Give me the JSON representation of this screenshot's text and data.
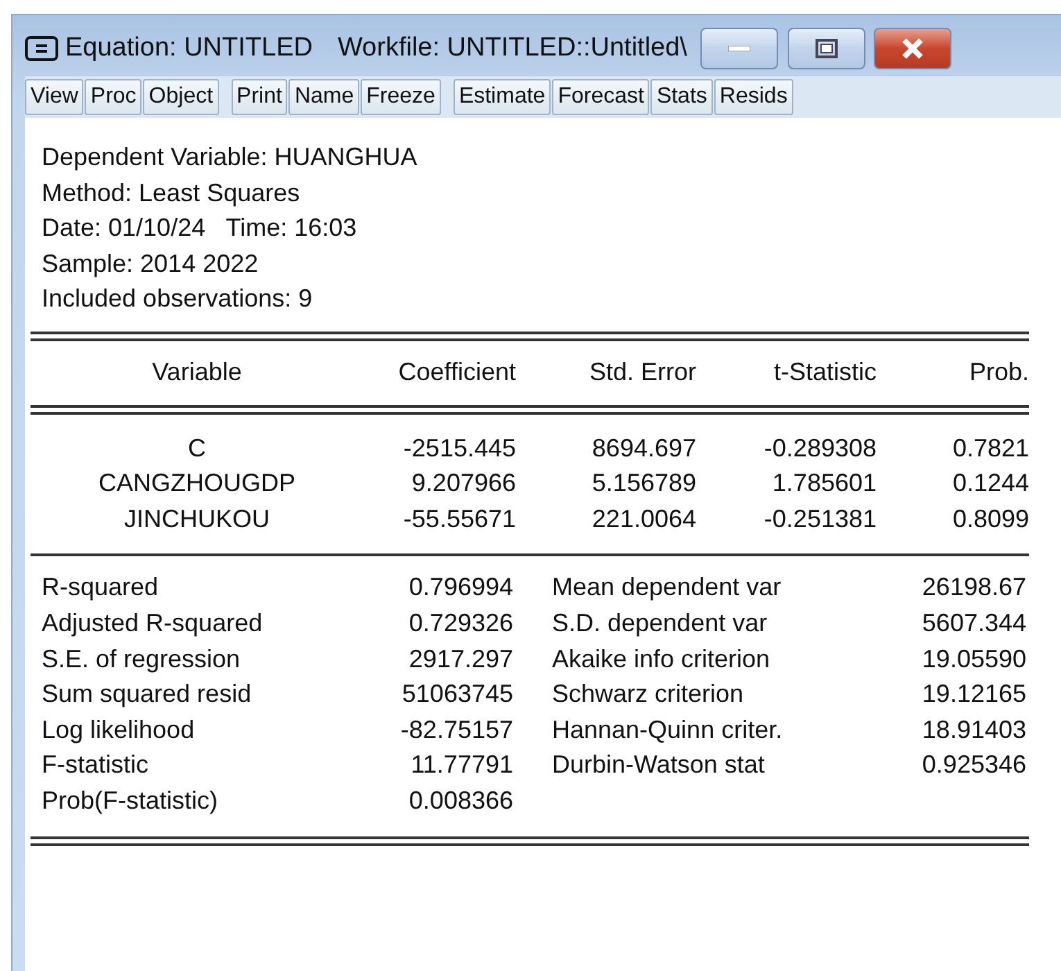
{
  "window": {
    "title": "Equation: UNTITLED",
    "workfile": "Workfile: UNTITLED::Untitled\\"
  },
  "toolbar": [
    [
      "View",
      "Proc",
      "Object"
    ],
    [
      "Print",
      "Name",
      "Freeze"
    ],
    [
      "Estimate",
      "Forecast",
      "Stats",
      "Resids"
    ]
  ],
  "header": [
    "Dependent Variable: HUANGHUA",
    "Method: Least Squares",
    "Date: 01/10/24   Time: 16:03",
    "Sample: 2014 2022",
    "Included observations: 9"
  ],
  "table": {
    "columns": [
      "Variable",
      "Coefficient",
      "Std. Error",
      "t-Statistic",
      "Prob."
    ],
    "rows": [
      [
        "C",
        "-2515.445",
        "8694.697",
        "-0.289308",
        "0.7821"
      ],
      [
        "CANGZHOUGDP",
        "9.207966",
        "5.156789",
        "1.785601",
        "0.1244"
      ],
      [
        "JINCHUKOU",
        "-55.55671",
        "221.0064",
        "-0.251381",
        "0.8099"
      ]
    ]
  },
  "statistics": [
    [
      "R-squared",
      "0.796994",
      "Mean dependent var",
      "26198.67"
    ],
    [
      "Adjusted R-squared",
      "0.729326",
      "S.D. dependent var",
      "5607.344"
    ],
    [
      "S.E. of regression",
      "2917.297",
      "Akaike info criterion",
      "19.05590"
    ],
    [
      "Sum squared resid",
      "51063745",
      "Schwarz criterion",
      "19.12165"
    ],
    [
      "Log likelihood",
      "-82.75157",
      "Hannan-Quinn criter.",
      "18.91403"
    ],
    [
      "F-statistic",
      "11.77791",
      "Durbin-Watson stat",
      "0.925346"
    ],
    [
      "Prob(F-statistic)",
      "0.008366"
    ]
  ]
}
